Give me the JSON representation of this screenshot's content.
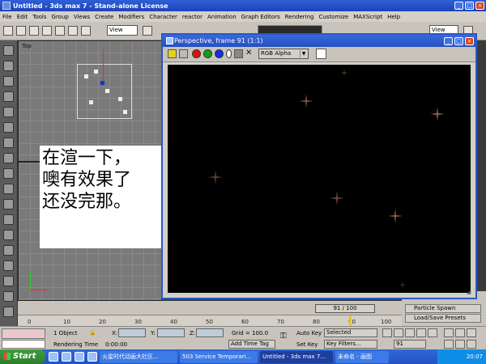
{
  "window": {
    "title": "Untitled - 3ds max 7 - Stand-alone License"
  },
  "menu": [
    "File",
    "Edit",
    "Tools",
    "Group",
    "Views",
    "Create",
    "Modifiers",
    "Character",
    "reactor",
    "Animation",
    "Graph Editors",
    "Rendering",
    "Customize",
    "MAXScript",
    "Help"
  ],
  "toolbar": {
    "view_dropdown": "View",
    "view_dropdown_right": "View"
  },
  "viewport": {
    "label": "Top"
  },
  "overlay_text": [
    "在渲一下，",
    "噢有效果了",
    "还没完那。"
  ],
  "render_window": {
    "title": "Perspective, frame 91 (1:1)",
    "channel": "RGB Alpha",
    "swatch_color": "#ffffff",
    "channel_dots": [
      "#e01010",
      "#10a010",
      "#1030e0"
    ]
  },
  "timeline": {
    "frame_display": "91 / 100",
    "current_frame": 91,
    "total_frames": 100,
    "ticks": [
      "0",
      "10",
      "20",
      "30",
      "40",
      "50",
      "60",
      "70",
      "80",
      "90",
      "100"
    ]
  },
  "right_panel": {
    "buttons": [
      "Particle Spawn",
      "Load/Save Presets"
    ]
  },
  "status": {
    "selection": "1 Object",
    "x_label": "X:",
    "y_label": "Y:",
    "z_label": "Z:",
    "grid": "Grid = 100.0",
    "rendering_time_label": "Rendering Time",
    "rendering_time": "0:00:00",
    "add_time_tag": "Add Time Tag",
    "auto_key": "Auto Key",
    "selected": "Selected",
    "set_key": "Set Key",
    "key_filters": "Key Filters...",
    "frame_spinner": "91"
  },
  "taskbar": {
    "start": "Start",
    "tasks": [
      "火星时代动画大社区...",
      "503 Service Temporari...",
      "Untitled - 3ds max 7...",
      "未命名 - 画图"
    ],
    "active_index": 2,
    "clock": "20:07"
  }
}
